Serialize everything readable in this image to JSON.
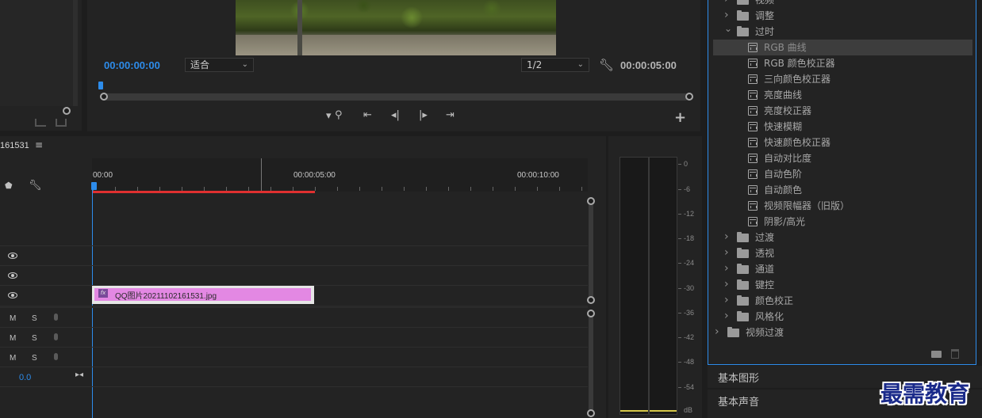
{
  "program": {
    "timecode_current": "00:00:00:00",
    "fit_select": "适合",
    "resolution_select": "1/2",
    "timecode_duration": "00:00:05:00"
  },
  "sequence": {
    "tab_name": "161531",
    "ruler": [
      "00:00",
      "00:00:05:00",
      "00:00:10:00"
    ],
    "clip_name": "QQ图片20211102161531.jpg",
    "audio_rows": [
      {
        "m": "M",
        "s": "S"
      },
      {
        "m": "M",
        "s": "S"
      },
      {
        "m": "M",
        "s": "S"
      }
    ],
    "master_volume": "0.0"
  },
  "meter": {
    "scale": [
      "0",
      "-6",
      "-12",
      "-18",
      "-24",
      "-30",
      "-36",
      "-42",
      "-48",
      "-54",
      "dB"
    ]
  },
  "effects": {
    "items": [
      {
        "label": "视频",
        "kind": "folder",
        "indent": 1,
        "open": false
      },
      {
        "label": "调整",
        "kind": "folder",
        "indent": 1,
        "open": false
      },
      {
        "label": "过时",
        "kind": "folder",
        "indent": 1,
        "open": true
      },
      {
        "label": "RGB 曲线",
        "kind": "effect",
        "indent": 2,
        "selected": true
      },
      {
        "label": "RGB 颜色校正器",
        "kind": "effect",
        "indent": 2
      },
      {
        "label": "三向颜色校正器",
        "kind": "effect",
        "indent": 2
      },
      {
        "label": "亮度曲线",
        "kind": "effect",
        "indent": 2
      },
      {
        "label": "亮度校正器",
        "kind": "effect",
        "indent": 2
      },
      {
        "label": "快速模糊",
        "kind": "effect",
        "indent": 2
      },
      {
        "label": "快速颜色校正器",
        "kind": "effect",
        "indent": 2
      },
      {
        "label": "自动对比度",
        "kind": "effect",
        "indent": 2
      },
      {
        "label": "自动色阶",
        "kind": "effect",
        "indent": 2
      },
      {
        "label": "自动颜色",
        "kind": "effect",
        "indent": 2
      },
      {
        "label": "视频限幅器（旧版）",
        "kind": "effect",
        "indent": 2
      },
      {
        "label": "阴影/高光",
        "kind": "effect",
        "indent": 2
      },
      {
        "label": "过渡",
        "kind": "folder",
        "indent": 1,
        "open": false
      },
      {
        "label": "透视",
        "kind": "folder",
        "indent": 1,
        "open": false
      },
      {
        "label": "通道",
        "kind": "folder",
        "indent": 1,
        "open": false
      },
      {
        "label": "键控",
        "kind": "folder",
        "indent": 1,
        "open": false
      },
      {
        "label": "颜色校正",
        "kind": "folder",
        "indent": 1,
        "open": false
      },
      {
        "label": "风格化",
        "kind": "folder",
        "indent": 1,
        "open": false
      },
      {
        "label": "视频过渡",
        "kind": "folder",
        "indent": 0,
        "open": false
      }
    ],
    "panel_essential_graphics": "基本图形",
    "panel_essential_sound": "基本声音"
  },
  "watermark": "最需教育"
}
